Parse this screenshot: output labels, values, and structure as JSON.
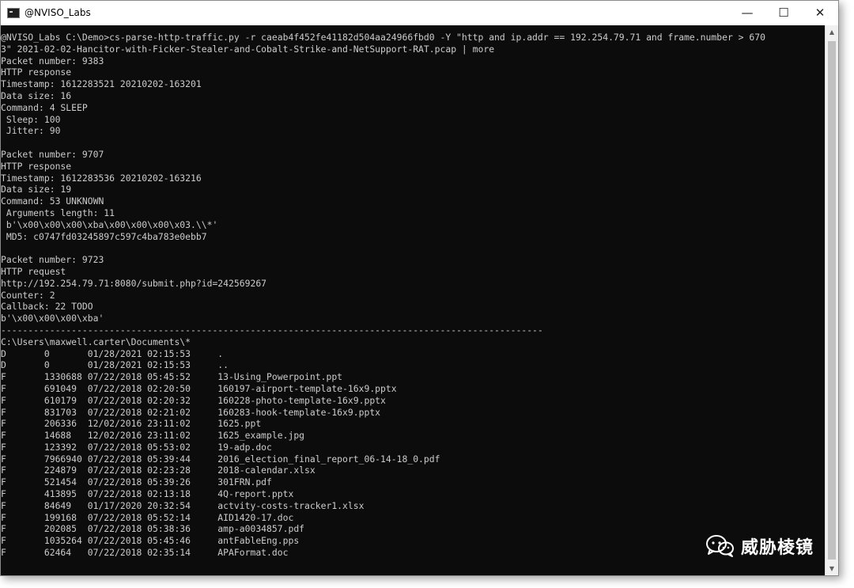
{
  "window": {
    "title": "@NVISO_Labs",
    "minimize_glyph": "—",
    "maximize_glyph": "☐",
    "close_glyph": "✕"
  },
  "terminal": {
    "lines": [
      "@NVISO_Labs C:\\Demo>cs-parse-http-traffic.py -r caeab4f452fe41182d504aa24966fbd0 -Y \"http and ip.addr == 192.254.79.71 and frame.number > 670",
      "3\" 2021-02-02-Hancitor-with-Ficker-Stealer-and-Cobalt-Strike-and-NetSupport-RAT.pcap | more",
      "Packet number: 9383",
      "HTTP response",
      "Timestamp: 1612283521 20210202-163201",
      "Data size: 16",
      "Command: 4 SLEEP",
      " Sleep: 100",
      " Jitter: 90",
      "",
      "Packet number: 9707",
      "HTTP response",
      "Timestamp: 1612283536 20210202-163216",
      "Data size: 19",
      "Command: 53 UNKNOWN",
      " Arguments length: 11",
      " b'\\x00\\x00\\x00\\xba\\x00\\x00\\x00\\x03.\\\\*'",
      " MD5: c0747fd03245897c597c4ba783e0ebb7",
      "",
      "Packet number: 9723",
      "HTTP request",
      "http://192.254.79.71:8080/submit.php?id=242569267",
      "Counter: 2",
      "Callback: 22 TODO",
      "b'\\x00\\x00\\x00\\xba'",
      "----------------------------------------------------------------------------------------------------",
      "C:\\Users\\maxwell.carter\\Documents\\*",
      "D       0       01/28/2021 02:15:53     .",
      "D       0       01/28/2021 02:15:53     ..",
      "F       1330688 07/22/2018 05:45:52     13-Using_Powerpoint.ppt",
      "F       691049  07/22/2018 02:20:50     160197-airport-template-16x9.pptx",
      "F       610179  07/22/2018 02:20:32     160228-photo-template-16x9.pptx",
      "F       831703  07/22/2018 02:21:02     160283-hook-template-16x9.pptx",
      "F       206336  12/02/2016 23:11:02     1625.ppt",
      "F       14688   12/02/2016 23:11:02     1625_example.jpg",
      "F       123392  07/22/2018 05:53:02     19-adp.doc",
      "F       7966940 07/22/2018 05:39:44     2016_election_final_report_06-14-18_0.pdf",
      "F       224879  07/22/2018 02:23:28     2018-calendar.xlsx",
      "F       521454  07/22/2018 05:39:26     301FRN.pdf",
      "F       413895  07/22/2018 02:13:18     4Q-report.pptx",
      "F       84649   01/17/2020 20:32:54     actvity-costs-tracker1.xlsx",
      "F       199168  07/22/2018 05:52:14     AID1420-17.doc",
      "F       202085  07/22/2018 05:38:36     amp-a0034857.pdf",
      "F       1035264 07/22/2018 05:45:46     antFableEng.pps",
      "F       62464   07/22/2018 02:35:14     APAFormat.doc"
    ]
  },
  "watermark": {
    "text": "威胁棱镜",
    "icon": "wechat-icon"
  },
  "colors": {
    "terminal_bg": "#0c0c0c",
    "terminal_fg": "#cccccc",
    "titlebar_bg": "#ffffff"
  }
}
